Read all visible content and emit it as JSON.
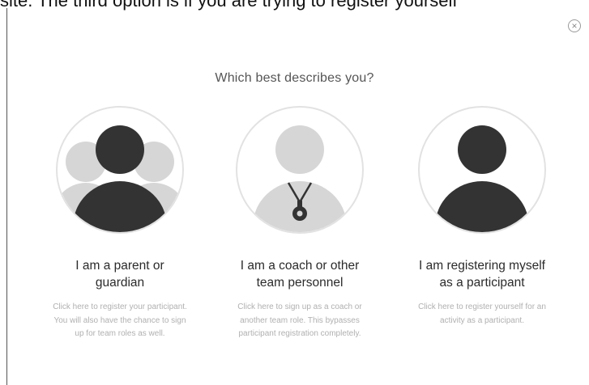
{
  "doc_text": "site. The third option is if you are trying to register yourself",
  "close_label": "×",
  "question": "Which best describes you?",
  "options": [
    {
      "title_line1": "I am a parent or",
      "title_line2": "guardian",
      "desc": "Click here to register your participant. You will also have the chance to sign up for team roles as well.",
      "icon": "parent-icon"
    },
    {
      "title_line1": "I am a coach or other",
      "title_line2": "team personnel",
      "desc": "Click here to sign up as a coach or another team role. This bypasses participant registration completely.",
      "icon": "coach-whistle-icon"
    },
    {
      "title_line1": "I am registering myself",
      "title_line2": "as a participant",
      "desc": "Click here to register yourself for an activity as a participant.",
      "icon": "participant-icon"
    }
  ],
  "colors": {
    "dark_silhouette": "#333333",
    "light_silhouette": "#d6d6d6",
    "circle_border": "#e2e2e2"
  }
}
